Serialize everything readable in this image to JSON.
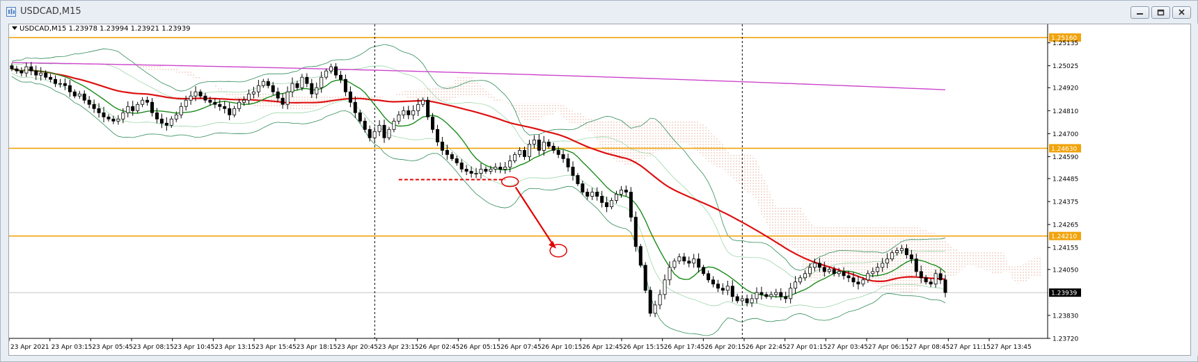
{
  "window": {
    "title": "USDCAD,M15",
    "buttons": [
      "minimize-icon",
      "restore-icon",
      "close-icon"
    ]
  },
  "chart": {
    "info_line": "USDCAD,M15  1.23978 1.23994 1.23921 1.23939"
  },
  "chart_data": {
    "type": "candlestick",
    "symbol": "USDCAD",
    "timeframe": "M15",
    "ohlc": {
      "open": 1.23978,
      "high": 1.23994,
      "low": 1.23921,
      "close": 1.23939
    },
    "ylim": [
      1.2372,
      1.2522
    ],
    "price_ticks": [
      "1.25135",
      "1.25025",
      "1.24920",
      "1.24810",
      "1.24700",
      "1.24590",
      "1.24485",
      "1.24375",
      "1.24265",
      "1.24155",
      "1.24050",
      "1.23830",
      "1.23720"
    ],
    "time_labels": [
      "23 Apr 2021",
      "23 Apr 03:15",
      "23 Apr 05:45",
      "23 Apr 08:15",
      "23 Apr 10:45",
      "23 Apr 13:15",
      "23 Apr 15:45",
      "23 Apr 18:15",
      "23 Apr 20:45",
      "23 Apr 23:15",
      "26 Apr 02:45",
      "26 Apr 05:15",
      "26 Apr 07:45",
      "26 Apr 10:15",
      "26 Apr 12:45",
      "26 Apr 15:15",
      "26 Apr 17:45",
      "26 Apr 20:15",
      "26 Apr 22:45",
      "27 Apr 01:15",
      "27 Apr 03:45",
      "27 Apr 06:15",
      "27 Apr 08:45",
      "27 Apr 11:15",
      "27 Apr 13:45"
    ],
    "horizontal_levels": [
      {
        "label": "1.25160",
        "value": 1.2516,
        "color": "#f0a30a"
      },
      {
        "label": "1.24630",
        "value": 1.2463,
        "color": "#f0a30a"
      },
      {
        "label": "1.24210",
        "value": 1.2421,
        "color": "#f0a30a"
      }
    ],
    "current_price_label": "1.23939",
    "current_price": 1.23939,
    "period_separators_after_label": [
      "23 Apr 20:45",
      "26 Apr 20:15"
    ],
    "indicators": [
      {
        "kind": "moving-average-slow",
        "color": "#cc44cc"
      },
      {
        "kind": "moving-average-medium",
        "color": "#dd1111"
      },
      {
        "kind": "moving-average-fast",
        "color": "#1a8a1a"
      },
      {
        "kind": "bollinger-bands",
        "color": "#2e8b57"
      },
      {
        "kind": "ichimoku-cloud",
        "color": "#d9a48a"
      }
    ],
    "annotations": [
      {
        "kind": "dashed-support-line",
        "color": "#e00000"
      },
      {
        "kind": "arrow",
        "color": "#e00000"
      }
    ],
    "closes": [
      1.2501,
      1.25,
      1.2499,
      1.2502,
      1.25,
      1.2498,
      1.2499,
      1.2497,
      1.2496,
      1.2494,
      1.2494,
      1.2493,
      1.249,
      1.2488,
      1.2489,
      1.2486,
      1.2484,
      1.2482,
      1.248,
      1.2478,
      1.2477,
      1.2476,
      1.2477,
      1.248,
      1.2483,
      1.2481,
      1.2484,
      1.2486,
      1.2485,
      1.248,
      1.2477,
      1.2475,
      1.2474,
      1.2477,
      1.2479,
      1.2483,
      1.2486,
      1.2488,
      1.249,
      1.2488,
      1.2486,
      1.2485,
      1.2484,
      1.2483,
      1.2482,
      1.2479,
      1.2482,
      1.2485,
      1.2486,
      1.2489,
      1.249,
      1.2493,
      1.2495,
      1.2493,
      1.249,
      1.2487,
      1.2484,
      1.249,
      1.2494,
      1.2492,
      1.2497,
      1.2494,
      1.2489,
      1.2492,
      1.2497,
      1.25,
      1.2502,
      1.2498,
      1.2496,
      1.249,
      1.2485,
      1.248,
      1.2476,
      1.2472,
      1.2468,
      1.2471,
      1.2474,
      1.2468,
      1.2472,
      1.2476,
      1.2479,
      1.2481,
      1.2479,
      1.2481,
      1.2484,
      1.2486,
      1.2478,
      1.2472,
      1.2466,
      1.2462,
      1.246,
      1.2458,
      1.2456,
      1.2453,
      1.2452,
      1.2451,
      1.2451,
      1.2453,
      1.2452,
      1.2453,
      1.2454,
      1.2453,
      1.2454,
      1.2457,
      1.246,
      1.2462,
      1.2459,
      1.2465,
      1.2467,
      1.2462,
      1.2466,
      1.2464,
      1.2462,
      1.246,
      1.2458,
      1.2454,
      1.245,
      1.2446,
      1.2442,
      1.244,
      1.2442,
      1.244,
      1.2437,
      1.2435,
      1.2438,
      1.2441,
      1.2443,
      1.2442,
      1.243,
      1.2416,
      1.2407,
      1.2395,
      1.2384,
      1.2388,
      1.2393,
      1.24,
      1.2406,
      1.2409,
      1.2411,
      1.2409,
      1.2408,
      1.241,
      1.2406,
      1.2403,
      1.24,
      1.2398,
      1.2396,
      1.2395,
      1.2397,
      1.2392,
      1.239,
      1.2391,
      1.2389,
      1.2391,
      1.2394,
      1.2393,
      1.2392,
      1.2393,
      1.2394,
      1.2392,
      1.2391,
      1.2396,
      1.2399,
      1.2401,
      1.2403,
      1.2406,
      1.2408,
      1.2406,
      1.2404,
      1.2405,
      1.2403,
      1.2404,
      1.2402,
      1.2401,
      1.2399,
      1.2398,
      1.24,
      1.2403,
      1.2404,
      1.2406,
      1.2408,
      1.241,
      1.2413,
      1.2414,
      1.2415,
      1.2412,
      1.241,
      1.2404,
      1.2401,
      1.2399,
      1.2398,
      1.2403,
      1.24,
      1.23939
    ]
  }
}
